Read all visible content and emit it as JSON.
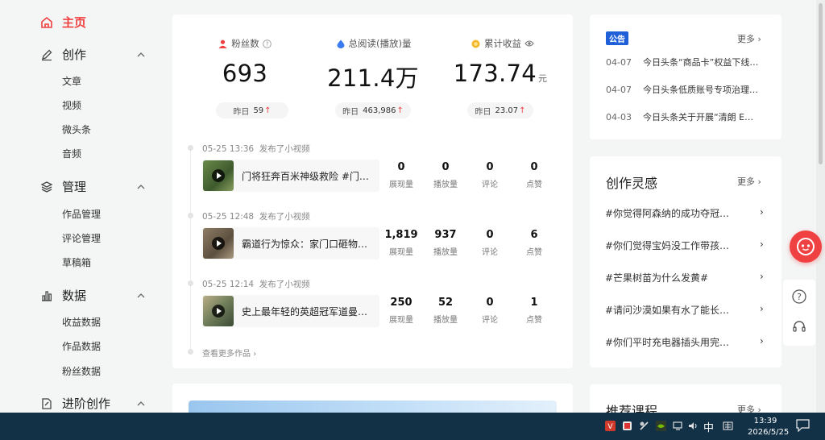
{
  "sidebar": {
    "home": "主页",
    "create": {
      "label": "创作",
      "items": [
        "文章",
        "视频",
        "微头条",
        "音频"
      ]
    },
    "manage": {
      "label": "管理",
      "items": [
        "作品管理",
        "评论管理",
        "草稿箱"
      ]
    },
    "data": {
      "label": "数据",
      "items": [
        "收益数据",
        "作品数据",
        "粉丝数据"
      ]
    },
    "advanced": {
      "label": "进阶创作"
    }
  },
  "stats": [
    {
      "label": "粉丝数",
      "value": "693",
      "unit": "",
      "yesterday_label": "昨日",
      "yesterday": "59"
    },
    {
      "label": "总阅读(播放)量",
      "value": "211.4万",
      "unit": "",
      "yesterday_label": "昨日",
      "yesterday": "463,986"
    },
    {
      "label": "累计收益",
      "value": "173.74",
      "unit": "元",
      "yesterday_label": "昨日",
      "yesterday": "23.07"
    }
  ],
  "posts": [
    {
      "time": "05-25 13:36",
      "action": "发布了小视频",
      "title": "门将狂奔百米神级救险 #门…",
      "views": "0",
      "plays": "0",
      "comments": "0",
      "likes": "0"
    },
    {
      "time": "05-25 12:48",
      "action": "发布了小视频",
      "title": "霸道行为惊众：家门口砸物…",
      "views": "1,819",
      "plays": "937",
      "comments": "0",
      "likes": "6"
    },
    {
      "time": "05-25 12:14",
      "action": "发布了小视频",
      "title": "史上最年轻的英超冠军道曼…",
      "views": "250",
      "plays": "52",
      "comments": "0",
      "likes": "1"
    }
  ],
  "metric_labels": {
    "views": "展现量",
    "plays": "播放量",
    "comments": "评论",
    "likes": "点赞"
  },
  "more_works": "查看更多作品",
  "announcement": {
    "badge": "公告",
    "more": "更多",
    "items": [
      {
        "date": "04-07",
        "text": "今日头条“商品卡”权益下线…"
      },
      {
        "date": "04-07",
        "text": "今日头条低质账号专项治理…"
      },
      {
        "date": "04-03",
        "text": "今日头条关于开展“清朗 E…"
      }
    ]
  },
  "inspiration": {
    "title": "创作灵感",
    "more": "更多",
    "items": [
      "#你觉得阿森纳的成功夺冠…",
      "#你们觉得宝妈没工作带孩…",
      "#芒果树苗为什么发黄#",
      "#请问沙漠如果有水了能长…",
      "#你们平时充电器插头用完…"
    ]
  },
  "courses": {
    "title": "推荐课程",
    "more": "更多"
  },
  "taskbar": {
    "ime": "中",
    "time": "13:39",
    "date": "2026/5/25"
  },
  "colors": {
    "accent": "#f04142",
    "badge": "#1f5fd8",
    "taskbar": "#123046"
  }
}
